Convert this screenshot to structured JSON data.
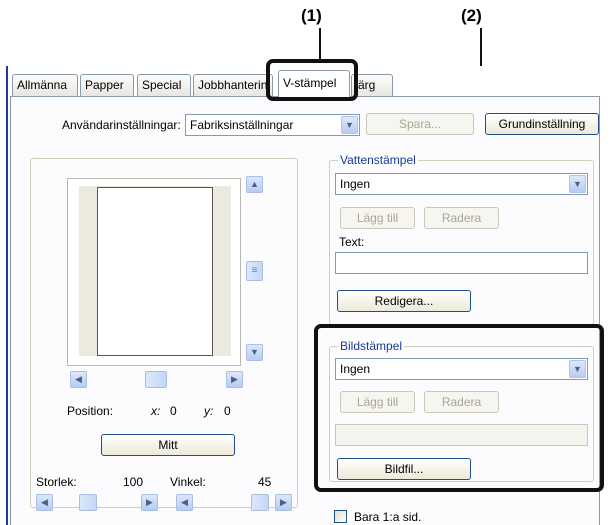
{
  "callouts": {
    "one": "(1)",
    "two": "(2)"
  },
  "tabs": [
    {
      "label": "Allmänna"
    },
    {
      "label": "Papper"
    },
    {
      "label": "Special"
    },
    {
      "label": "Jobbhanterin"
    },
    {
      "label": "V-stämpel"
    },
    {
      "label": "ärg"
    }
  ],
  "settings_row": {
    "label": "Användarinställningar:",
    "value": "Fabriksinställningar",
    "save_label": "Spara...",
    "default_label": "Grundinställning"
  },
  "preview": {
    "position_label": "Position:",
    "x_label": "x:",
    "x_value": "0",
    "y_label": "y:",
    "y_value": "0",
    "center_label": "Mitt",
    "size_label": "Storlek:",
    "size_value": "100",
    "angle_label": "Vinkel:",
    "angle_value": "45"
  },
  "watermark": {
    "title": "Vattenstämpel",
    "selected": "Ingen",
    "add_label": "Lägg till",
    "delete_label": "Radera",
    "text_label": "Text:",
    "text_value": "",
    "edit_label": "Redigera..."
  },
  "image_stamp": {
    "title": "Bildstämpel",
    "selected": "Ingen",
    "add_label": "Lägg till",
    "delete_label": "Radera",
    "file_value": "",
    "file_label": "Bildfil..."
  },
  "first_page_only": {
    "label": "Bara 1:a sid."
  },
  "icons": {
    "up": "▲",
    "down": "▼",
    "left": "◀",
    "right": "▶",
    "grip": "≡"
  }
}
